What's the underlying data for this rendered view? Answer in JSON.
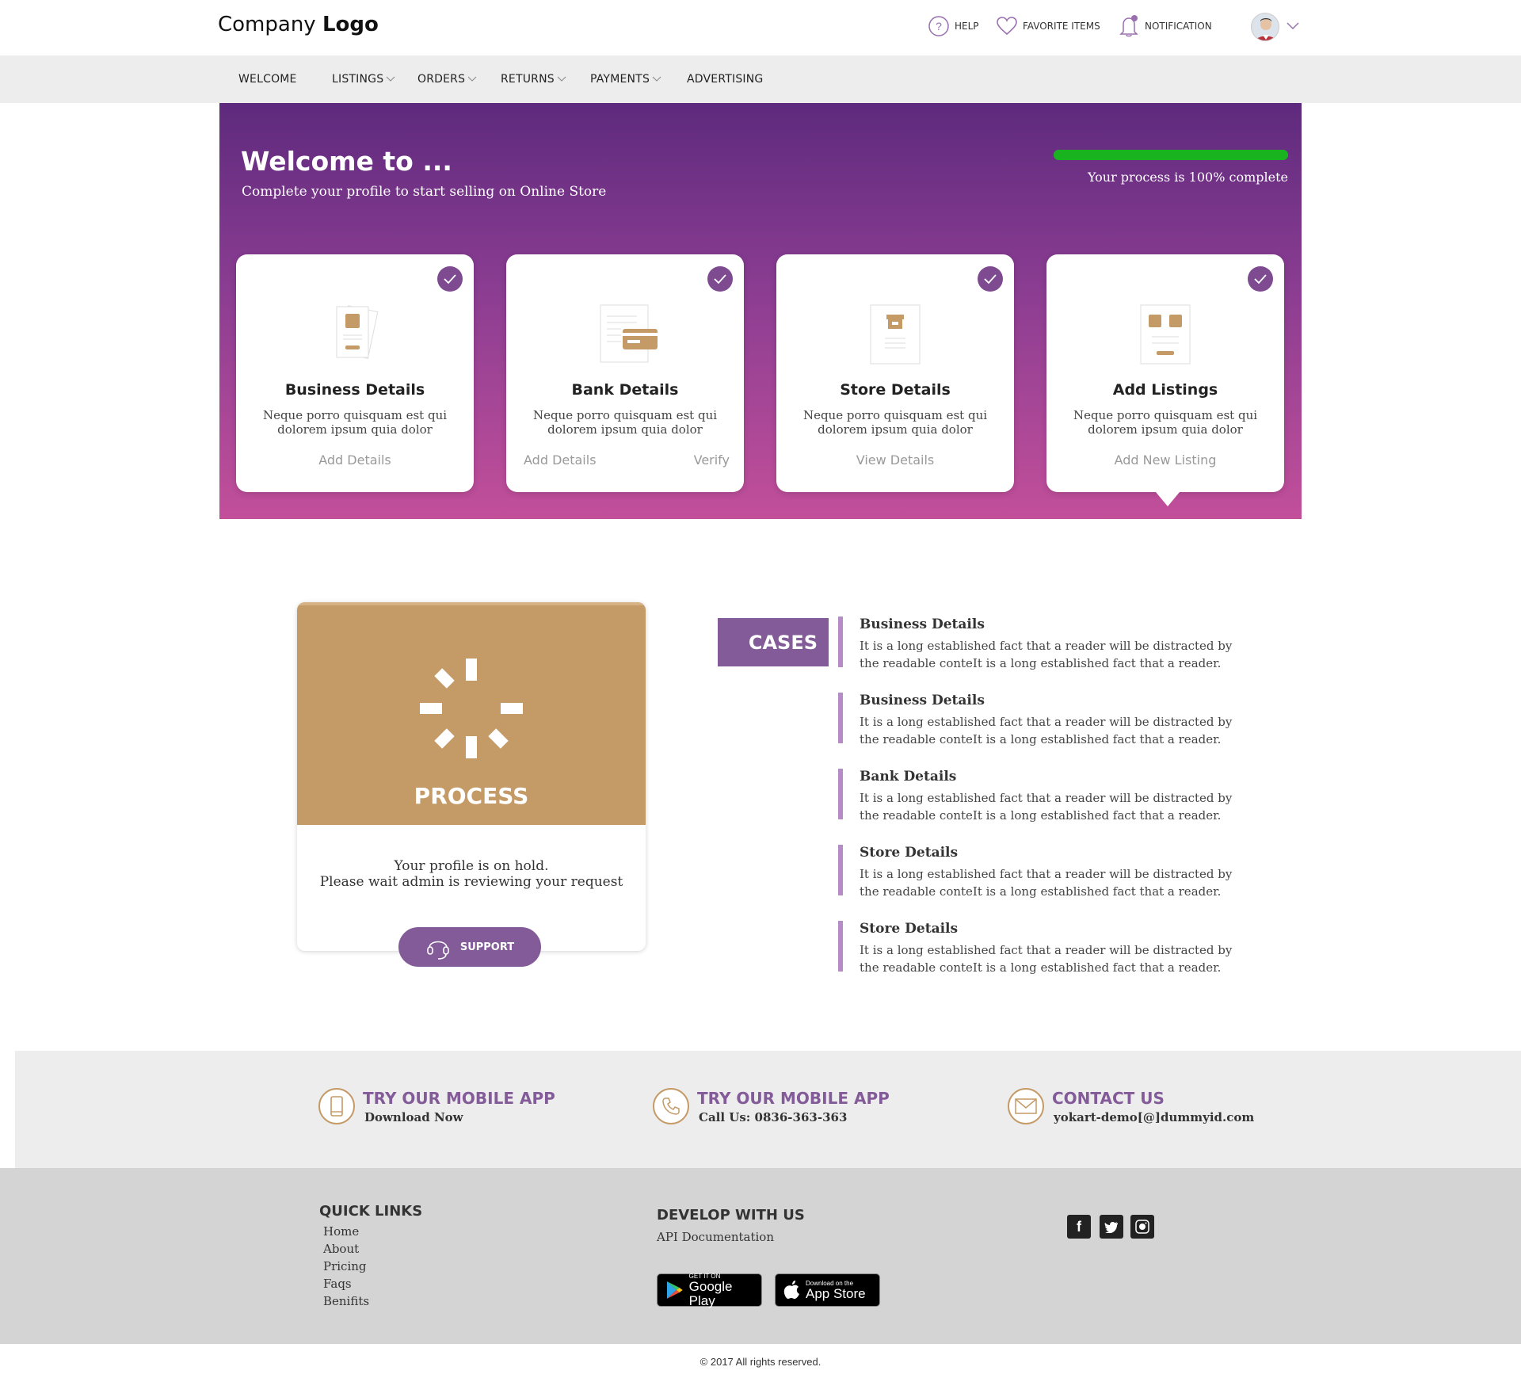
{
  "header": {
    "logo_prefix": "Company",
    "logo_bold": "Logo",
    "help": "HELP",
    "favorites": "FAVORITE ITEMS",
    "notification": "NOTIFICATION"
  },
  "nav": {
    "items": [
      {
        "label": "WELCOME",
        "has_dropdown": false
      },
      {
        "label": "LISTINGS",
        "has_dropdown": true
      },
      {
        "label": "ORDERS",
        "has_dropdown": true
      },
      {
        "label": "RETURNS",
        "has_dropdown": true
      },
      {
        "label": "PAYMENTS",
        "has_dropdown": true
      },
      {
        "label": "ADVERTISING",
        "has_dropdown": false
      }
    ]
  },
  "hero": {
    "title": "Welcome to ...",
    "subtitle": "Complete your profile to start selling on Online Store",
    "progress_percent": 100,
    "progress_text": "Your process is 100% complete",
    "cards": [
      {
        "title": "Business Details",
        "desc": "Neque porro quisquam est qui dolorem ipsum quia dolor",
        "link1": "Add Details",
        "link2": "",
        "icon": "document-icon"
      },
      {
        "title": "Bank Details",
        "desc": "Neque porro quisquam est qui dolorem ipsum quia dolor",
        "link1": "Add Details",
        "link2": "Verify",
        "icon": "bank-card-icon"
      },
      {
        "title": "Store Details",
        "desc": "Neque porro quisquam est qui dolorem ipsum quia dolor",
        "link1": "View Details",
        "link2": "",
        "icon": "store-icon"
      },
      {
        "title": "Add Listings",
        "desc": "Neque porro quisquam est qui dolorem ipsum quia dolor",
        "link1": "Add New Listing",
        "link2": "",
        "icon": "listings-icon"
      }
    ]
  },
  "process": {
    "title": "PROCESS",
    "msg_line1": "Your profile is on hold.",
    "msg_line2": "Please wait admin is reviewing your request",
    "support": "SUPPORT"
  },
  "cases": {
    "tag": "CASES",
    "items": [
      {
        "title": "Business Details",
        "desc": "It is a long established fact that a reader will be distracted by the readable conteIt is a long established fact that a reader."
      },
      {
        "title": "Business Details",
        "desc": "It is a long established fact that a reader will be distracted by the readable conteIt is a long established fact that a reader."
      },
      {
        "title": "Bank Details",
        "desc": "It is a long established fact that a reader will be distracted by the readable conteIt is a long established fact that a reader."
      },
      {
        "title": "Store Details",
        "desc": "It is a long established fact that a reader will be distracted by the readable conteIt is a long established fact that a reader."
      },
      {
        "title": "Store Details",
        "desc": "It is a long established fact that a reader will be distracted by the readable conteIt is a long established fact that a reader."
      }
    ]
  },
  "footer_contact": [
    {
      "title": "TRY OUR MOBILE APP",
      "sub": "Download Now",
      "icon": "mobile-icon"
    },
    {
      "title": "TRY OUR MOBILE APP",
      "sub": "Call Us: 0836-363-363",
      "icon": "phone-icon"
    },
    {
      "title": "CONTACT US",
      "sub": "yokart-demo[@]dummyid.com",
      "icon": "mail-icon"
    }
  ],
  "footer": {
    "quick_links_heading": "QUICK LINKS",
    "quick_links": [
      "Home",
      "About",
      "Pricing",
      "Faqs",
      "Benifits"
    ],
    "develop_heading": "DEVELOP WITH US",
    "api_doc": "API Documentation",
    "google_small": "GET IT ON",
    "google_big": "Google Play",
    "apple_small": "Download on the",
    "apple_big": "App Store",
    "copyright": "© 2017 All rights reserved."
  },
  "colors": {
    "accent_purple": "#825b98",
    "hero_top": "#5e2a7d",
    "hero_bottom": "#c24f9a",
    "tan": "#c49a67",
    "progress_green": "#19b31f"
  }
}
